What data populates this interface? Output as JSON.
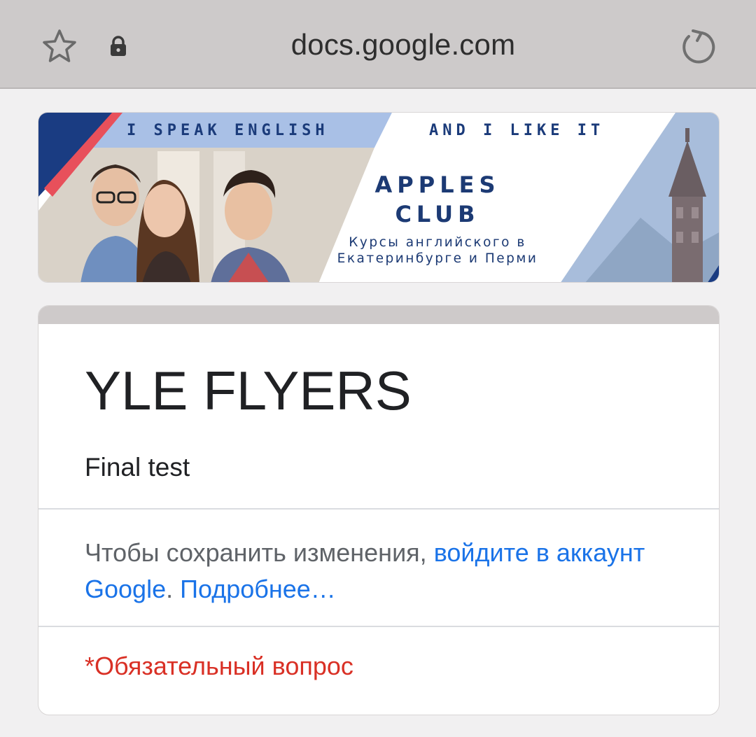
{
  "browser": {
    "url": "docs.google.com"
  },
  "banner": {
    "tagline_left": "I SPEAK ENGLISH",
    "tagline_right": "AND I LIKE IT",
    "brand_line1": "APPLES",
    "brand_line2": "CLUB",
    "description": "Курсы английского в Екатеринбурге и Перми"
  },
  "form": {
    "title": "YLE FLYERS",
    "description": "Final test",
    "signin_prefix": "Чтобы сохранить изменения, ",
    "signin_link": "войдите в аккаунт Google",
    "signin_separator": ". ",
    "learn_more_link": "Подробнее…",
    "required_note": "*Обязательный вопрос"
  },
  "colors": {
    "link": "#1a73e8",
    "required": "#d93025",
    "brand": "#1c3a74"
  }
}
